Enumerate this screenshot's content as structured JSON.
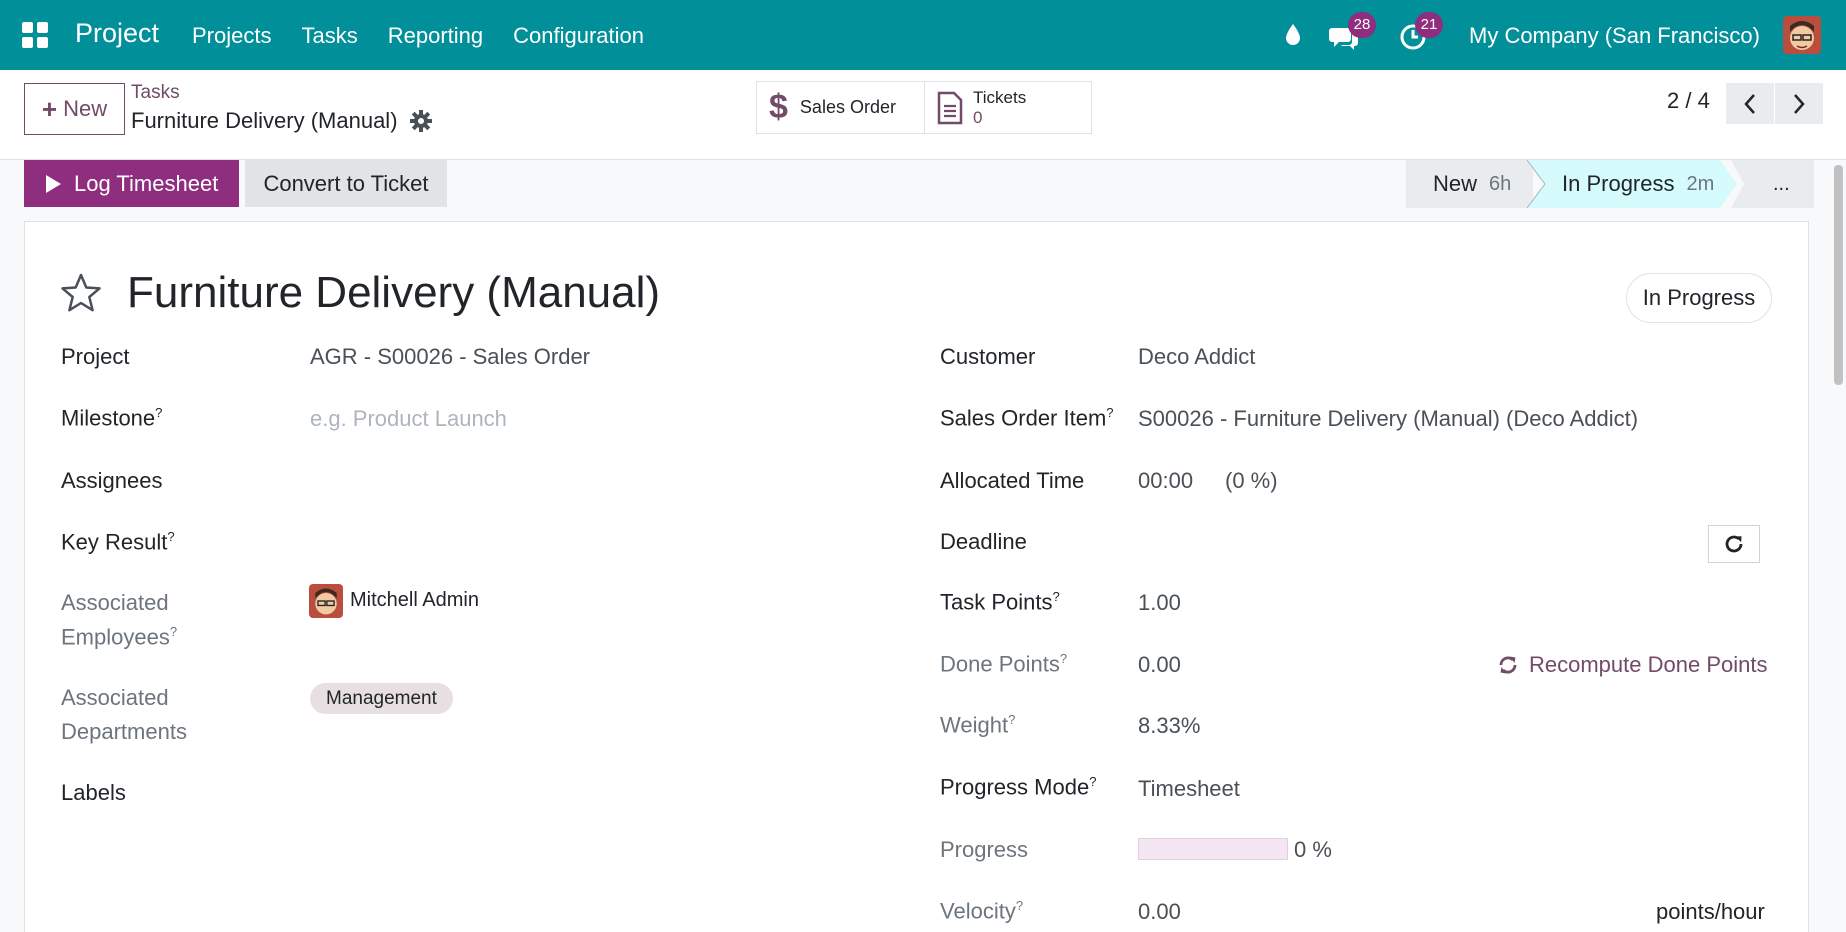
{
  "navbar": {
    "app_title": "Project",
    "menu": [
      "Projects",
      "Tasks",
      "Reporting",
      "Configuration"
    ],
    "messages_count": "28",
    "activities_count": "21",
    "company": "My Company (San Francisco)",
    "brand_color": "#018f99"
  },
  "control_panel": {
    "new_label": "New",
    "breadcrumb_parent": "Tasks",
    "breadcrumb_current": "Furniture Delivery (Manual)",
    "smart_buttons": {
      "sales_order": "Sales Order",
      "tickets_label": "Tickets",
      "tickets_count": "0"
    },
    "pager": "2 / 4"
  },
  "actions": {
    "log_timesheet": "Log Timesheet",
    "convert_to_ticket": "Convert to Ticket"
  },
  "stages": {
    "new_label": "New",
    "new_duration": "6h",
    "in_progress_label": "In Progress",
    "in_progress_duration": "2m",
    "more": "..."
  },
  "form": {
    "title": "Furniture Delivery (Manual)",
    "state": "In Progress",
    "left": {
      "project_label": "Project",
      "project_value": "AGR - S00026 - Sales Order",
      "milestone_label": "Milestone",
      "milestone_placeholder": "e.g. Product Launch",
      "assignees_label": "Assignees",
      "key_result_label": "Key Result",
      "assoc_employees_label_1": "Associated",
      "assoc_employees_label_2": "Employees",
      "employee_name": "Mitchell Admin",
      "assoc_departments_label_1": "Associated",
      "assoc_departments_label_2": "Departments",
      "department_tag": "Management",
      "labels_label": "Labels"
    },
    "right": {
      "customer_label": "Customer",
      "customer_value": "Deco Addict",
      "so_item_label": "Sales Order Item",
      "so_item_value": "S00026 - Furniture Delivery (Manual) (Deco Addict)",
      "allocated_label": "Allocated Time",
      "allocated_value": "00:00",
      "allocated_pct": "(0 %)",
      "deadline_label": "Deadline",
      "task_points_label": "Task Points",
      "task_points_value": "1.00",
      "done_points_label": "Done Points",
      "done_points_value": "0.00",
      "recompute_label": "Recompute Done Points",
      "weight_label": "Weight",
      "weight_value": "8.33%",
      "progress_mode_label": "Progress Mode",
      "progress_mode_value": "Timesheet",
      "progress_label": "Progress",
      "progress_value": 0,
      "progress_text": "0 %",
      "velocity_label": "Velocity",
      "velocity_value": "0.00",
      "velocity_unit": "points/hour"
    }
  }
}
